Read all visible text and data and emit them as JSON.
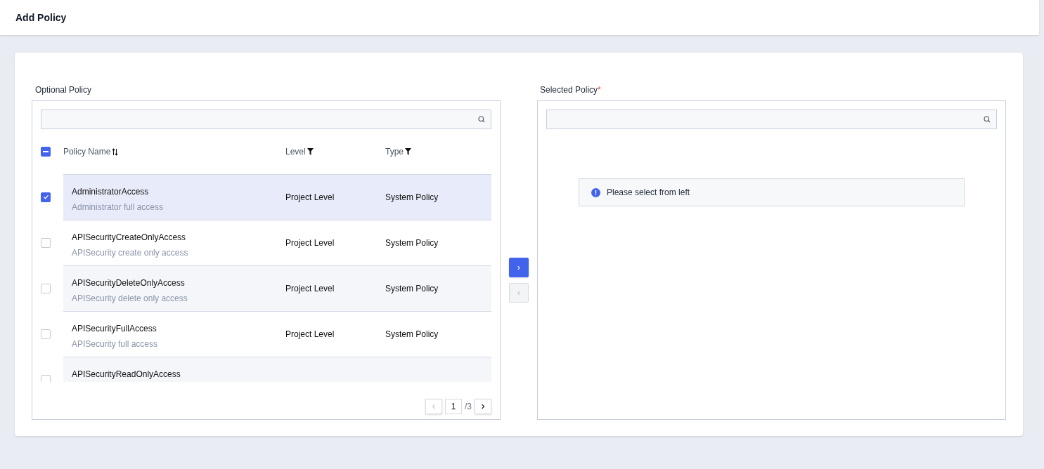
{
  "header": {
    "title": "Add Policy"
  },
  "optional": {
    "label": "Optional Policy",
    "select_all": {
      "indeterminate": true
    },
    "columns": [
      {
        "label": "Policy Name",
        "kind": "sort"
      },
      {
        "label": "Level",
        "kind": "filter"
      },
      {
        "label": "Type",
        "kind": "filter"
      }
    ],
    "rows": [
      {
        "name": "AdministratorAccess",
        "description": "Administrator full access",
        "level": "Project Level",
        "type": "System Policy",
        "checked": true
      },
      {
        "name": "APISecurityCreateOnlyAccess",
        "description": "APISecurity create only access",
        "level": "Project Level",
        "type": "System Policy",
        "checked": false
      },
      {
        "name": "APISecurityDeleteOnlyAccess",
        "description": "APISecurity delete only access",
        "level": "Project Level",
        "type": "System Policy",
        "checked": false
      },
      {
        "name": "APISecurityFullAccess",
        "description": "APISecurity full access",
        "level": "Project Level",
        "type": "System Policy",
        "checked": false
      },
      {
        "name": "APISecurityReadOnlyAccess",
        "checked": false
      }
    ],
    "pagination": {
      "prev_disabled": true,
      "page": "1",
      "total": "/3",
      "next_disabled": false
    }
  },
  "transfer": {
    "add": {
      "label": "›",
      "disabled": false
    },
    "remove": {
      "label": "‹",
      "disabled": true
    }
  },
  "selected": {
    "label": "Selected Policy",
    "required_mark": "*",
    "empty_message": "Please select from left"
  }
}
